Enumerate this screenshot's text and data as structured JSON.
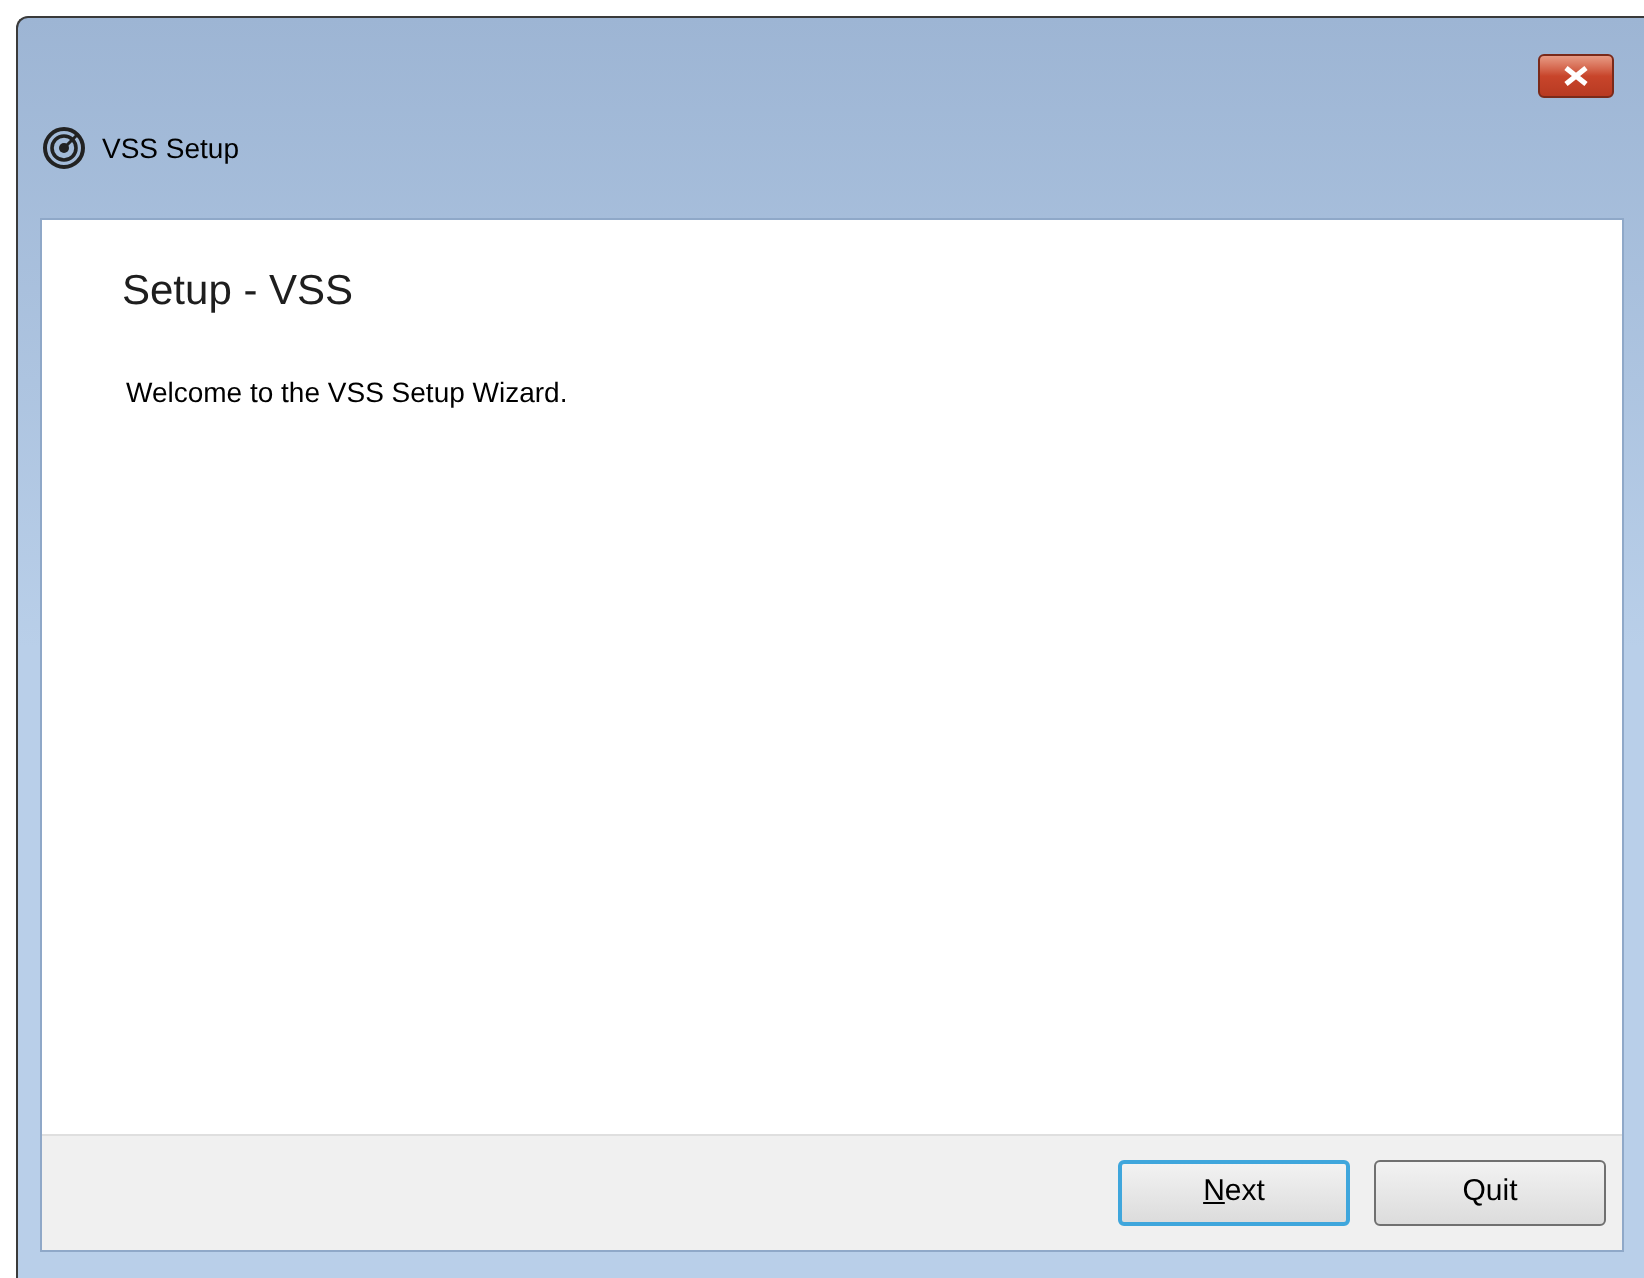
{
  "window": {
    "title": "VSS Setup"
  },
  "page": {
    "heading": "Setup - VSS",
    "text": "Welcome to the VSS Setup Wizard."
  },
  "buttons": [
    {
      "label": "Next",
      "default": true,
      "first_letter_underlined": true
    },
    {
      "label": "Quit",
      "default": false
    }
  ]
}
